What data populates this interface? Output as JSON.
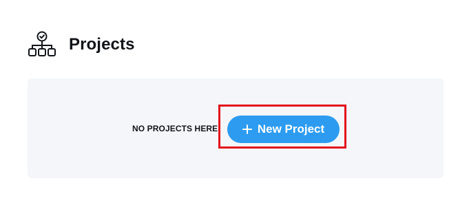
{
  "header": {
    "icon": "project-hierarchy-icon",
    "title": "Projects"
  },
  "empty_state": {
    "message": "NO PROJECTS HERE",
    "button": {
      "icon": "plus-icon",
      "label": "New Project"
    }
  },
  "colors": {
    "accent": "#2d9cf0",
    "panel_bg": "#f4f6f9",
    "highlight": "#e3101c",
    "text": "#111418"
  }
}
